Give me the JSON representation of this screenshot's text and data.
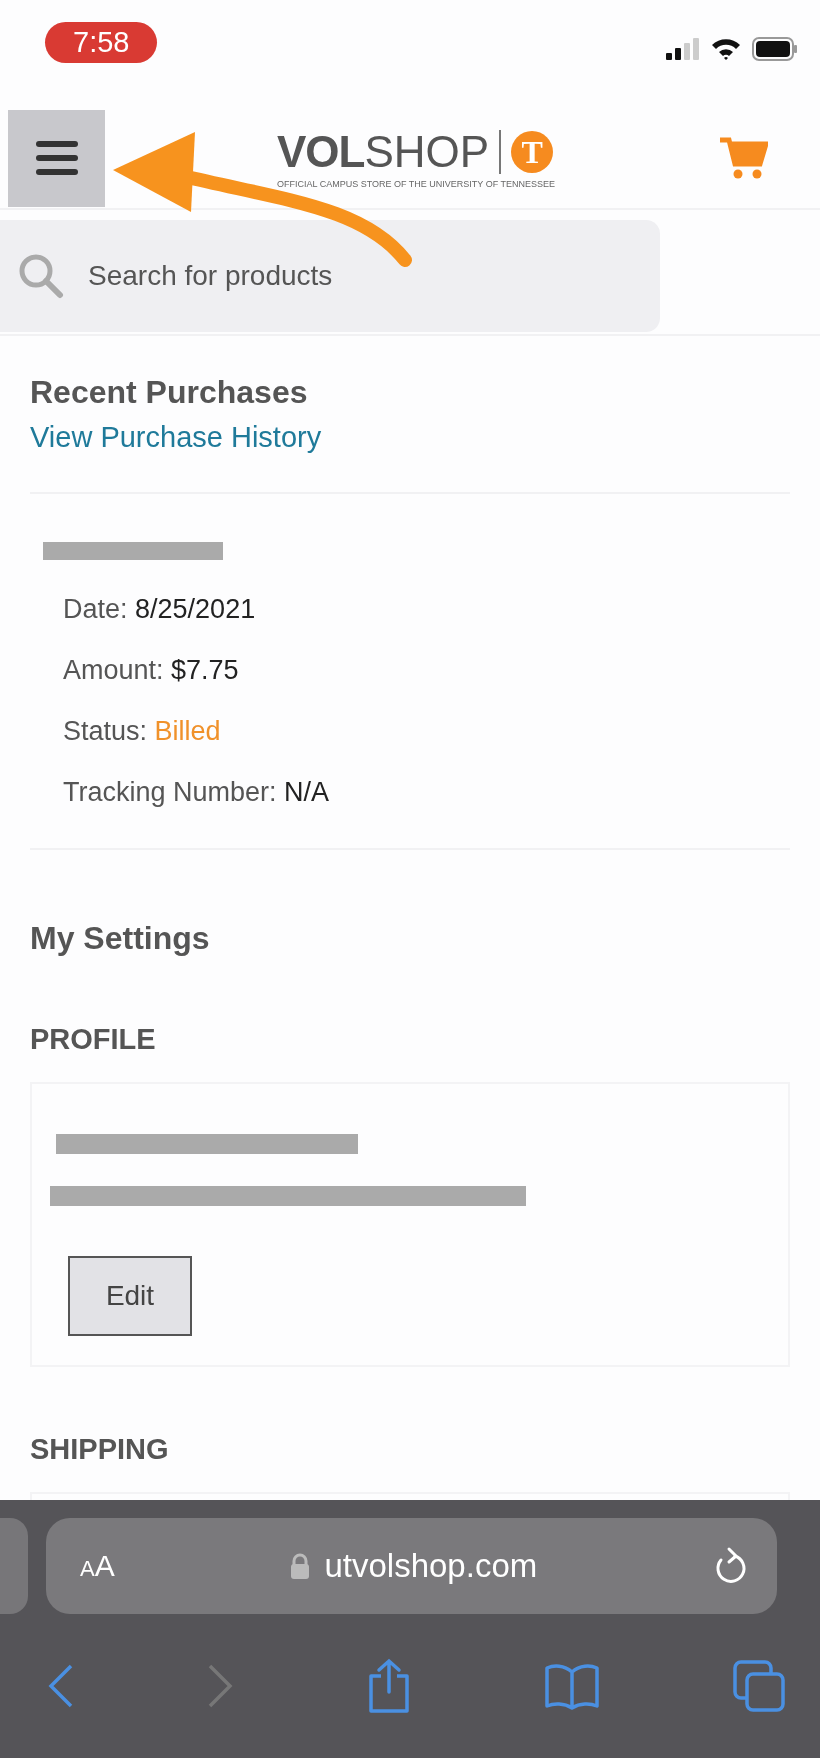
{
  "status_bar": {
    "time": "7:58"
  },
  "header": {
    "logo": {
      "word_bold": "VOL",
      "word_light": "SHOP",
      "mark": "T",
      "tagline": "OFFICIAL CAMPUS STORE OF THE UNIVERSITY OF TENNESSEE"
    }
  },
  "search": {
    "placeholder": "Search for products"
  },
  "recent_purchases": {
    "title": "Recent Purchases",
    "link": "View Purchase History",
    "order_fields": [
      {
        "label": "Date:",
        "value": "8/25/2021",
        "kind": "plain"
      },
      {
        "label": "Amount:",
        "value": "$7.75",
        "kind": "plain"
      },
      {
        "label": "Status:",
        "value": "Billed",
        "kind": "status"
      },
      {
        "label": "Tracking Number:",
        "value": "N/A",
        "kind": "plain"
      }
    ]
  },
  "settings": {
    "title": "My Settings",
    "sections": [
      {
        "heading": "PROFILE",
        "button": "Edit"
      },
      {
        "heading": "SHIPPING"
      }
    ]
  },
  "browser": {
    "text_size": "AA",
    "url": "utvolshop.com",
    "forward_disabled": true
  }
}
